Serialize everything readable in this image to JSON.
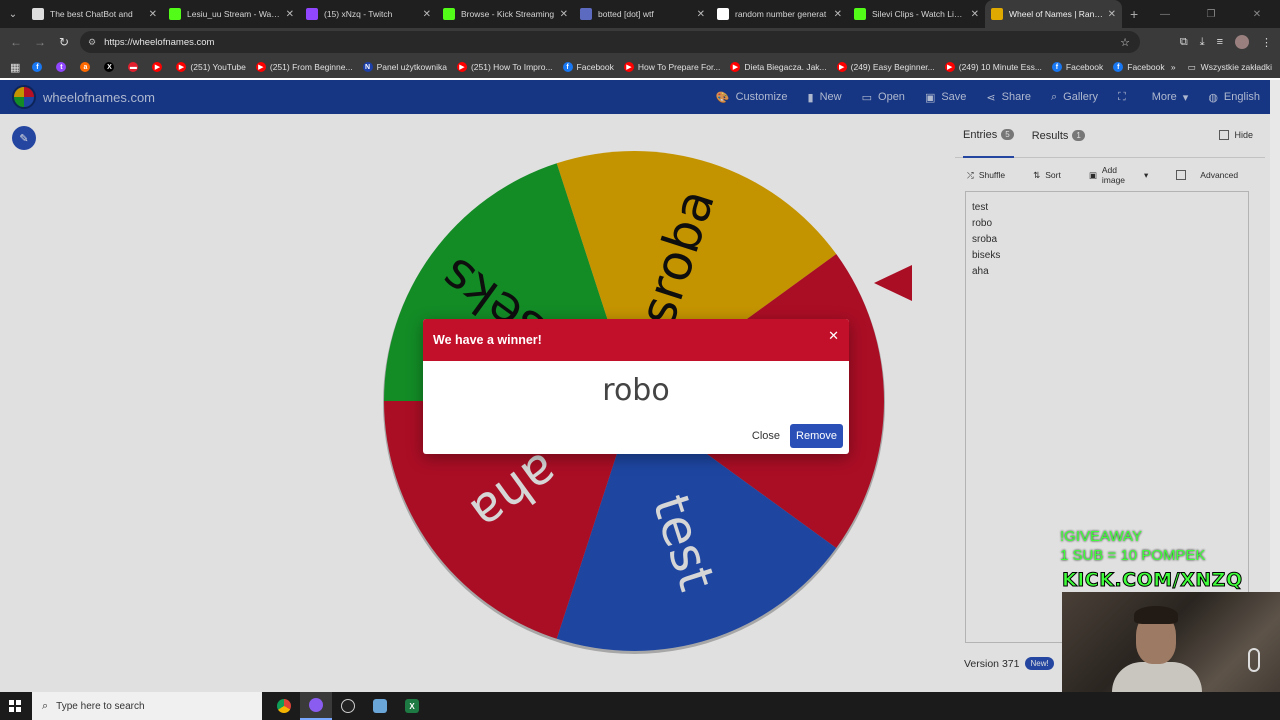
{
  "browser": {
    "tabs": [
      {
        "title": "The best ChatBot and",
        "icon": "chatbot-icon",
        "color": "#dddddd",
        "active": false
      },
      {
        "title": "Lesiu_uu Stream - Watch",
        "icon": "kick-icon",
        "color": "#53fc18",
        "active": false
      },
      {
        "title": "(15) xNzq - Twitch",
        "icon": "twitch-icon",
        "color": "#9146ff",
        "active": false
      },
      {
        "title": "Browse - Kick Streaming",
        "icon": "kick-icon",
        "color": "#53fc18",
        "active": false
      },
      {
        "title": "botted [dot] wtf",
        "icon": "discord-icon",
        "color": "#5c6bc0",
        "active": false
      },
      {
        "title": "random number generat",
        "icon": "google-icon",
        "color": "#ffffff",
        "active": false
      },
      {
        "title": "Silevi Clips - Watch Live a",
        "icon": "kick-icon",
        "color": "#53fc18",
        "active": false
      },
      {
        "title": "Wheel of Names | Rando",
        "icon": "wheel-icon",
        "color": "#e0a900",
        "active": true
      }
    ],
    "url": "https://wheelofnames.com",
    "bookmarks": [
      {
        "label": "",
        "color": "#1877f2",
        "glyph": "f"
      },
      {
        "label": "",
        "color": "#9146ff",
        "glyph": "t"
      },
      {
        "label": "",
        "color": "#ff6a00",
        "glyph": "a"
      },
      {
        "label": "",
        "color": "#000000",
        "glyph": "X"
      },
      {
        "label": "",
        "color": "#e01e2d",
        "glyph": "▬"
      },
      {
        "label": "",
        "color": "#ff0000",
        "glyph": "▶"
      },
      {
        "label": "(251) YouTube",
        "color": "#ff0000",
        "glyph": "▶"
      },
      {
        "label": "(251) From Beginne...",
        "color": "#ff0000",
        "glyph": "▶"
      },
      {
        "label": "Panel użytkownika",
        "color": "#1c3faa",
        "glyph": "N"
      },
      {
        "label": "(251) How To Impro...",
        "color": "#ff0000",
        "glyph": "▶"
      },
      {
        "label": "Facebook",
        "color": "#1877f2",
        "glyph": "f"
      },
      {
        "label": "How To Prepare For...",
        "color": "#ff0000",
        "glyph": "▶"
      },
      {
        "label": "Dieta Biegacza. Jak...",
        "color": "#ff0000",
        "glyph": "▶"
      },
      {
        "label": "(249) Easy Beginner...",
        "color": "#ff0000",
        "glyph": "▶"
      },
      {
        "label": "(249) 10 Minute Ess...",
        "color": "#ff0000",
        "glyph": "▶"
      },
      {
        "label": "Facebook",
        "color": "#1877f2",
        "glyph": "f"
      },
      {
        "label": "Facebook",
        "color": "#1877f2",
        "glyph": "f"
      }
    ],
    "all_bookmarks": "Wszystkie zakładki"
  },
  "app": {
    "site_name": "wheelofnames.com",
    "menu": [
      {
        "label": "Customize",
        "icon": "palette-icon",
        "glyph": "🎨"
      },
      {
        "label": "New",
        "icon": "file-icon",
        "glyph": "▮"
      },
      {
        "label": "Open",
        "icon": "folder-icon",
        "glyph": "▭"
      },
      {
        "label": "Save",
        "icon": "floppy-icon",
        "glyph": "▣"
      },
      {
        "label": "Share",
        "icon": "share-icon",
        "glyph": "⋖"
      },
      {
        "label": "Gallery",
        "icon": "search-icon",
        "glyph": "⌕"
      },
      {
        "label": "",
        "icon": "fullscreen-icon",
        "glyph": "⛶"
      },
      {
        "label": "More",
        "icon": "caret-down-icon",
        "glyph": ""
      },
      {
        "label": "English",
        "icon": "globe-icon",
        "glyph": "◍"
      }
    ],
    "wheel": {
      "segments": [
        {
          "label": "robo",
          "color": "#c2102b"
        },
        {
          "label": "test",
          "color": "#2350b8"
        },
        {
          "label": "aha",
          "color": "#c2102b"
        },
        {
          "label": "biseks",
          "color": "#16a02c"
        },
        {
          "label": "sroba",
          "color": "#e0a900"
        }
      ]
    },
    "panel": {
      "entries_tab": "Entries",
      "entries_count": "5",
      "results_tab": "Results",
      "results_count": "1",
      "hide_label": "Hide",
      "tools": {
        "shuffle": "Shuffle",
        "sort": "Sort",
        "add_image": "Add image",
        "advanced": "Advanced"
      },
      "entries": [
        "test",
        "robo",
        "sroba",
        "biseks",
        "aha"
      ],
      "version": "Version 371",
      "new_badge": "New!"
    },
    "modal": {
      "title": "We have a winner!",
      "winner": "robo",
      "close_label": "Close",
      "remove_label": "Remove"
    }
  },
  "stream_overlay": {
    "line1": "!GIVEAWAY",
    "line2": "1 SUB = 10 POMPEK",
    "kick": "KICK.COM/XNZQ"
  },
  "taskbar": {
    "search_placeholder": "Type here to search"
  }
}
